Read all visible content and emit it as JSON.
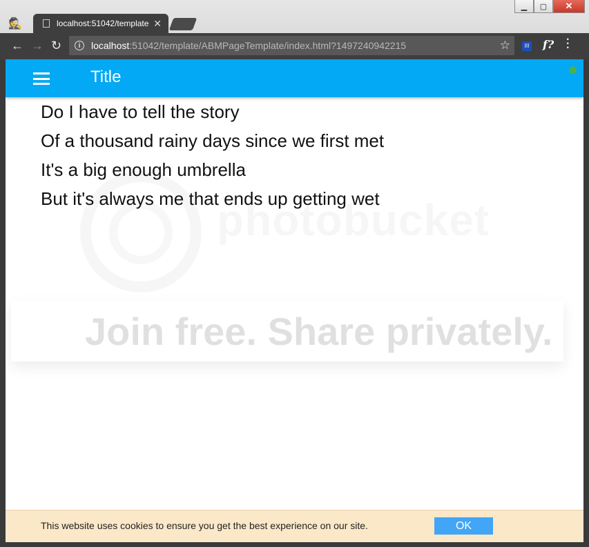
{
  "browser": {
    "tab_title": "localhost:51042/template",
    "url_host": "localhost",
    "url_path": ":51042/template/ABMPageTemplate/index.html?1497240942215",
    "ext_label": "f?",
    "win_min": "▁",
    "win_max": "▢",
    "win_close": "✕"
  },
  "app": {
    "title": "Title"
  },
  "lyrics": [
    "Do I have to tell the story",
    "Of a thousand rainy days since we first met",
    "It's a big enough umbrella",
    "But it's always me that ends up getting wet"
  ],
  "watermark": {
    "brand": "photobucket",
    "slogan": "Join free. Share privately."
  },
  "cookie_bar": {
    "message": "This website uses cookies to ensure you get the best experience on our site.",
    "ok_label": "OK"
  },
  "colors": {
    "appbar": "#03a9f4",
    "ok_button": "#42a5f5",
    "cookie_bg": "#fbe8c8",
    "status_dot": "#4caf50"
  }
}
